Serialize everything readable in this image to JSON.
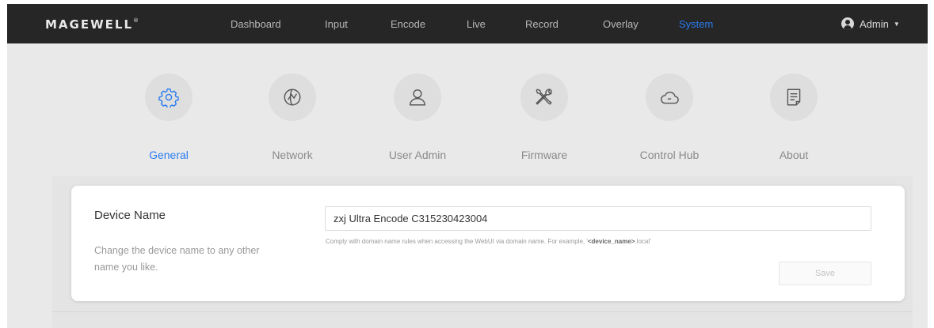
{
  "brand": {
    "logo": "MAGEWELL",
    "registered": "®"
  },
  "nav": {
    "items": [
      {
        "label": "Dashboard"
      },
      {
        "label": "Input"
      },
      {
        "label": "Encode"
      },
      {
        "label": "Live"
      },
      {
        "label": "Record"
      },
      {
        "label": "Overlay"
      },
      {
        "label": "System"
      }
    ],
    "active": "System",
    "user": "Admin"
  },
  "categories": [
    {
      "label": "General",
      "icon": "gear-icon",
      "active": true
    },
    {
      "label": "Network",
      "icon": "network-icon",
      "active": false
    },
    {
      "label": "User Admin",
      "icon": "user-icon",
      "active": false
    },
    {
      "label": "Firmware",
      "icon": "tools-icon",
      "active": false
    },
    {
      "label": "Control Hub",
      "icon": "cloud-icon",
      "active": false
    },
    {
      "label": "About",
      "icon": "document-icon",
      "active": false
    }
  ],
  "device": {
    "title": "Device Name",
    "description": "Change the device name to any other name you like.",
    "value": "zxj Ultra Encode C315230423004",
    "hint_prefix": "Comply with domain name rules when accessing the WebUI via domain name. For example, '",
    "hint_bold": "<device_name>",
    "hint_suffix": ".local'",
    "save_label": "Save"
  },
  "colors": {
    "accent": "#2a7cf0",
    "topbar": "#262626",
    "background": "#e9e9e9"
  }
}
